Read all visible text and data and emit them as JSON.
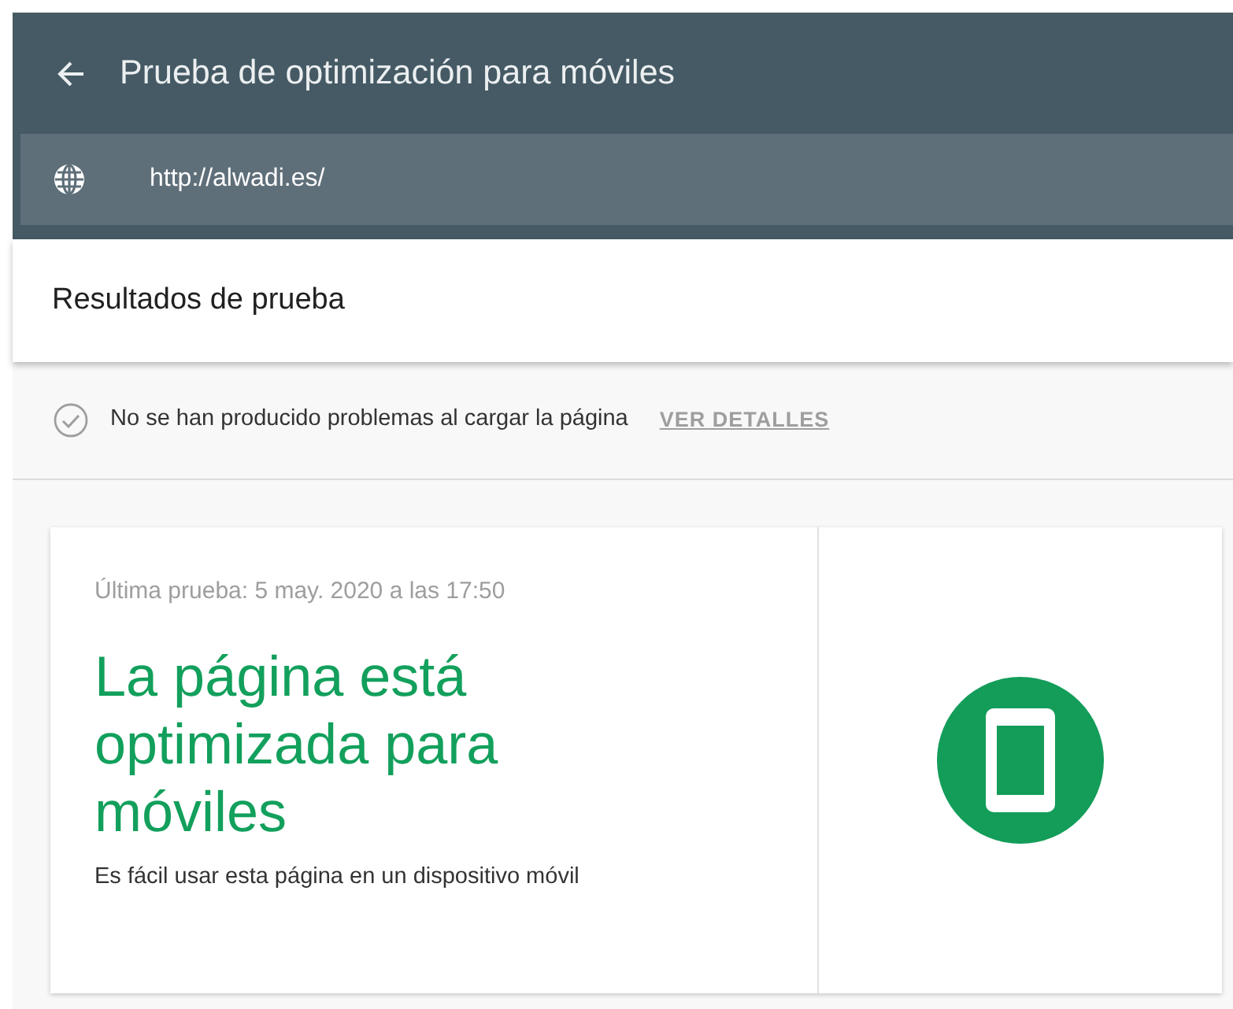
{
  "header": {
    "title": "Prueba de optimización para móviles",
    "url": "http://alwadi.es/"
  },
  "section_title": "Resultados de prueba",
  "status": {
    "message": "No se han producido problemas al cargar la página",
    "action": "VER DETALLES"
  },
  "result": {
    "last_test": "Última prueba: 5 may. 2020 a las 17:50",
    "headline": "La página está optimizada para móviles",
    "description": "Es fácil usar esta página en un dispositivo móvil"
  }
}
